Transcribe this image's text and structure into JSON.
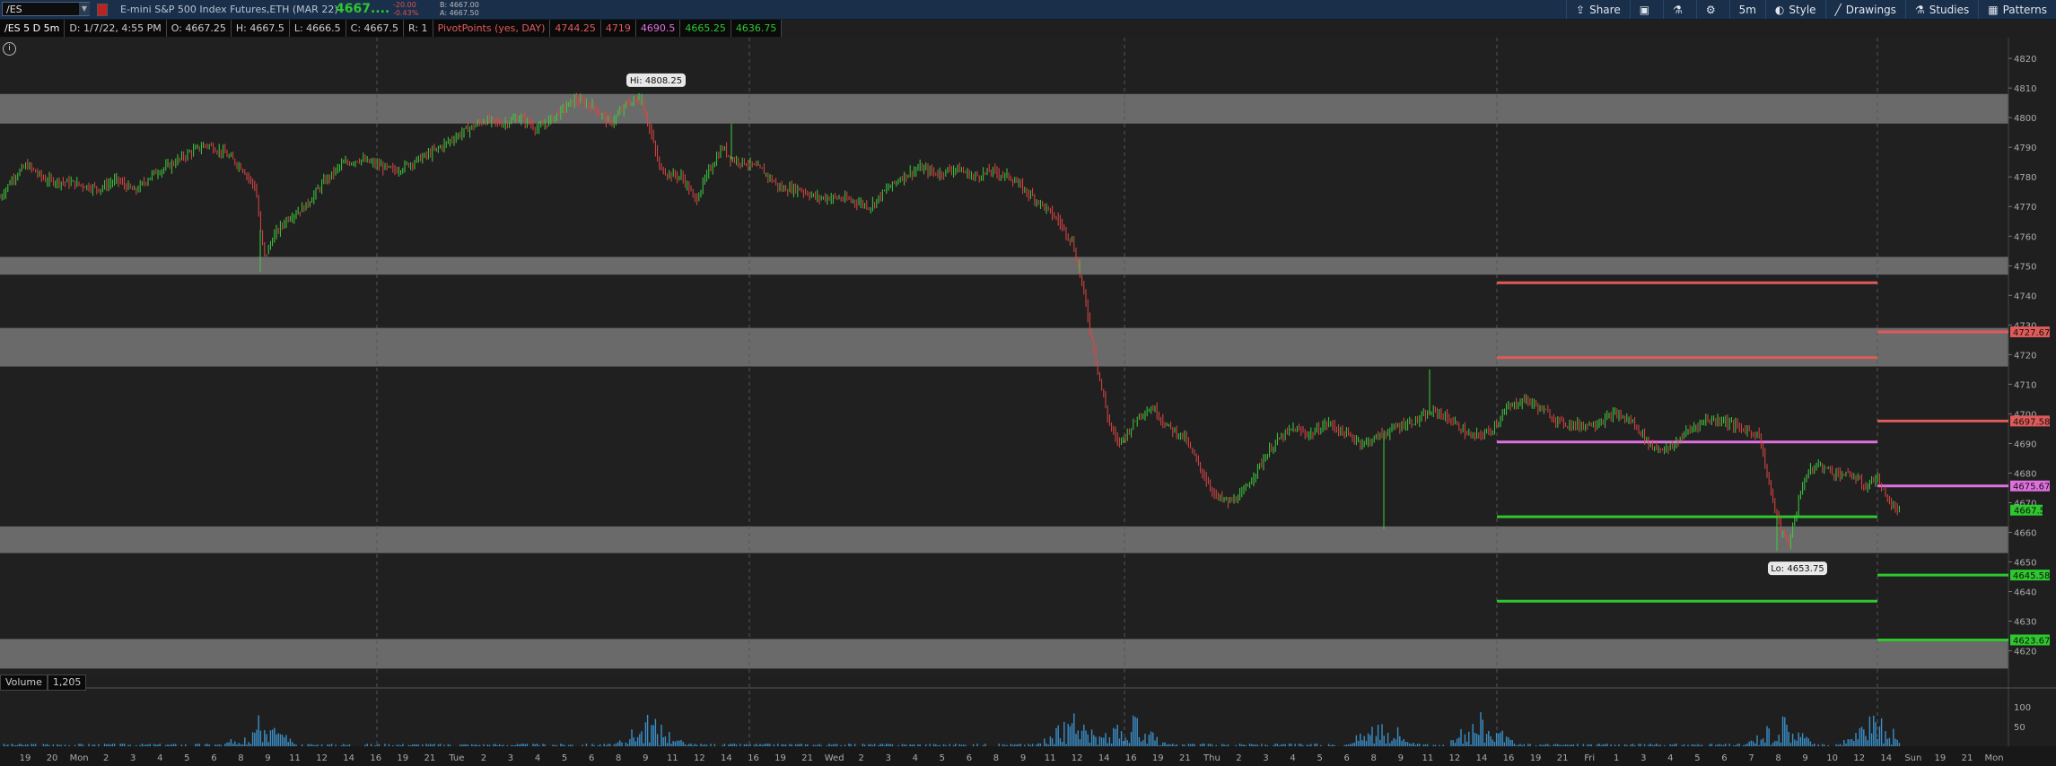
{
  "toolbar": {
    "symbol": "/ES",
    "instrument_name": "E-mini S&P 500 Index Futures,ETH (MAR 22)",
    "last_price": "4667....",
    "net_change": "-20.00",
    "pct_change": "-0.43%",
    "bid": "B: 4667.00",
    "ask": "A: 4667.50",
    "buttons": [
      {
        "icon": "share-icon",
        "glyph": "⇪",
        "label": "Share"
      },
      {
        "icon": "snapshot-icon",
        "glyph": "▣",
        "label": ""
      },
      {
        "icon": "flask-icon",
        "glyph": "⚗",
        "label": ""
      },
      {
        "icon": "gear-icon",
        "glyph": "⚙",
        "label": ""
      },
      {
        "icon": "",
        "glyph": "",
        "label": "5m"
      },
      {
        "icon": "style-icon",
        "glyph": "◐",
        "label": "Style"
      },
      {
        "icon": "drawings-icon",
        "glyph": "╱",
        "label": "Drawings"
      },
      {
        "icon": "studies-icon",
        "glyph": "⚗",
        "label": "Studies"
      },
      {
        "icon": "patterns-icon",
        "glyph": "▦",
        "label": "Patterns"
      }
    ]
  },
  "info_bar": {
    "title": "/ES 5 D 5m",
    "date": "D: 1/7/22, 4:55 PM",
    "open": "O: 4667.25",
    "high": "H: 4667.5",
    "low": "L: 4666.5",
    "close": "C: 4667.5",
    "range": "R: 1",
    "study": "PivotPoints (yes, DAY)",
    "pivot_values": [
      "4744.25",
      "4719",
      "4690.5",
      "4665.25",
      "4636.75"
    ],
    "pivot_colors": [
      "#e05a5a",
      "#e05a5a",
      "#e070e0",
      "#2ec82e",
      "#2ec82e"
    ]
  },
  "volume_header": {
    "label": "Volume",
    "value": "1,205"
  },
  "chart_data": {
    "type": "candlestick",
    "y_ticks": [
      4620,
      4630,
      4640,
      4650,
      4660,
      4670,
      4680,
      4690,
      4700,
      4710,
      4720,
      4730,
      4740,
      4750,
      4760,
      4770,
      4780,
      4790,
      4800,
      4810,
      4820
    ],
    "ylim": [
      4612,
      4827
    ],
    "volume_ticks": [
      "50",
      "100"
    ],
    "x_labels": [
      "19",
      "20",
      "Mon",
      "2",
      "3",
      "4",
      "5",
      "6",
      "8",
      "9",
      "11",
      "12",
      "14",
      "16",
      "19",
      "21",
      "Tue",
      "2",
      "3",
      "4",
      "5",
      "6",
      "8",
      "9",
      "11",
      "12",
      "14",
      "16",
      "19",
      "21",
      "Wed",
      "2",
      "3",
      "4",
      "5",
      "6",
      "8",
      "9",
      "11",
      "12",
      "14",
      "16",
      "19",
      "21",
      "Thu",
      "2",
      "3",
      "4",
      "5",
      "6",
      "8",
      "9",
      "11",
      "12",
      "14",
      "16",
      "19",
      "21",
      "Fri",
      "1",
      "3",
      "4",
      "5",
      "6",
      "7",
      "8",
      "9",
      "10",
      "12",
      "14",
      "Sun",
      "19",
      "21",
      "Mon"
    ],
    "zones": [
      {
        "from": 4798,
        "to": 4808
      },
      {
        "from": 4747,
        "to": 4753
      },
      {
        "from": 4716,
        "to": 4729
      },
      {
        "from": 4653,
        "to": 4662
      },
      {
        "from": 4614,
        "to": 4624
      }
    ],
    "pivot_lines": [
      {
        "y": 4744.25,
        "color": "#e05a5a"
      },
      {
        "y": 4719,
        "color": "#e05a5a"
      },
      {
        "y": 4690.5,
        "color": "#e070e0"
      },
      {
        "y": 4665.25,
        "color": "#2ec82e"
      },
      {
        "y": 4636.75,
        "color": "#2ec82e"
      }
    ],
    "projection_lines": [
      {
        "y": 4727.67,
        "label": "4727.67",
        "color": "#e05a5a"
      },
      {
        "y": 4697.58,
        "label": "4697.58",
        "color": "#e05a5a"
      },
      {
        "y": 4675.67,
        "label": "4675.67",
        "color": "#e070e0"
      },
      {
        "y": 4645.58,
        "label": "4645.58",
        "color": "#2ec82e"
      },
      {
        "y": 4623.67,
        "label": "4623.67",
        "color": "#2ec82e"
      }
    ],
    "last_price_label": {
      "y": 4667.5,
      "label": "4667.5",
      "color": "#2ec82e"
    },
    "hi_callout": {
      "label": "Hi: 4808.25",
      "y": 4808.25
    },
    "lo_callout": {
      "label": "Lo: 4653.75",
      "y": 4653.75
    },
    "price_path": [
      [
        0,
        4773
      ],
      [
        15,
        4780
      ],
      [
        30,
        4784
      ],
      [
        50,
        4779
      ],
      [
        80,
        4778
      ],
      [
        110,
        4776
      ],
      [
        130,
        4779
      ],
      [
        150,
        4775
      ],
      [
        170,
        4781
      ],
      [
        190,
        4784
      ],
      [
        210,
        4788
      ],
      [
        230,
        4791
      ],
      [
        250,
        4788
      ],
      [
        270,
        4783
      ],
      [
        285,
        4776
      ],
      [
        290,
        4762
      ],
      [
        295,
        4753
      ],
      [
        305,
        4760
      ],
      [
        320,
        4766
      ],
      [
        340,
        4770
      ],
      [
        360,
        4778
      ],
      [
        380,
        4784
      ],
      [
        400,
        4786
      ],
      [
        420,
        4784
      ],
      [
        440,
        4782
      ],
      [
        460,
        4785
      ],
      [
        480,
        4788
      ],
      [
        500,
        4792
      ],
      [
        520,
        4796
      ],
      [
        540,
        4799
      ],
      [
        560,
        4798
      ],
      [
        580,
        4800
      ],
      [
        600,
        4796
      ],
      [
        620,
        4801
      ],
      [
        640,
        4806
      ],
      [
        660,
        4804
      ],
      [
        680,
        4798
      ],
      [
        700,
        4805
      ],
      [
        715,
        4806
      ],
      [
        725,
        4795
      ],
      [
        735,
        4783
      ],
      [
        745,
        4781
      ],
      [
        760,
        4780
      ],
      [
        775,
        4772
      ],
      [
        790,
        4782
      ],
      [
        805,
        4790
      ],
      [
        815,
        4786
      ],
      [
        830,
        4785
      ],
      [
        850,
        4782
      ],
      [
        870,
        4776
      ],
      [
        890,
        4776
      ],
      [
        910,
        4773
      ],
      [
        930,
        4773
      ],
      [
        950,
        4772
      ],
      [
        970,
        4770
      ],
      [
        985,
        4775
      ],
      [
        1005,
        4780
      ],
      [
        1025,
        4783
      ],
      [
        1045,
        4781
      ],
      [
        1065,
        4783
      ],
      [
        1085,
        4780
      ],
      [
        1105,
        4782
      ],
      [
        1125,
        4780
      ],
      [
        1140,
        4776
      ],
      [
        1160,
        4771
      ],
      [
        1180,
        4765
      ],
      [
        1195,
        4758
      ],
      [
        1205,
        4745
      ],
      [
        1215,
        4728
      ],
      [
        1225,
        4712
      ],
      [
        1235,
        4698
      ],
      [
        1245,
        4690
      ],
      [
        1255,
        4693
      ],
      [
        1270,
        4700
      ],
      [
        1285,
        4702
      ],
      [
        1300,
        4696
      ],
      [
        1320,
        4692
      ],
      [
        1340,
        4680
      ],
      [
        1355,
        4672
      ],
      [
        1370,
        4670
      ],
      [
        1385,
        4673
      ],
      [
        1400,
        4681
      ],
      [
        1420,
        4690
      ],
      [
        1440,
        4695
      ],
      [
        1460,
        4693
      ],
      [
        1480,
        4697
      ],
      [
        1500,
        4693
      ],
      [
        1520,
        4690
      ],
      [
        1540,
        4693
      ],
      [
        1560,
        4696
      ],
      [
        1580,
        4698
      ],
      [
        1600,
        4701
      ],
      [
        1620,
        4697
      ],
      [
        1640,
        4692
      ],
      [
        1660,
        4694
      ],
      [
        1680,
        4702
      ],
      [
        1700,
        4705
      ],
      [
        1720,
        4701
      ],
      [
        1740,
        4697
      ],
      [
        1760,
        4696
      ],
      [
        1780,
        4697
      ],
      [
        1800,
        4700
      ],
      [
        1820,
        4697
      ],
      [
        1840,
        4689
      ],
      [
        1860,
        4688
      ],
      [
        1880,
        4694
      ],
      [
        1900,
        4698
      ],
      [
        1920,
        4698
      ],
      [
        1940,
        4695
      ],
      [
        1960,
        4693
      ],
      [
        1975,
        4671
      ],
      [
        1985,
        4660
      ],
      [
        1993,
        4656
      ],
      [
        2000,
        4665
      ],
      [
        2010,
        4678
      ],
      [
        2025,
        4683
      ],
      [
        2045,
        4680
      ],
      [
        2065,
        4679
      ],
      [
        2080,
        4675
      ],
      [
        2090,
        4679
      ],
      [
        2100,
        4673
      ],
      [
        2110,
        4668
      ],
      [
        2118,
        4667.5
      ]
    ],
    "volume_bursts": [
      290,
      725,
      1195,
      1260,
      1540,
      1650,
      1985,
      2090
    ]
  }
}
